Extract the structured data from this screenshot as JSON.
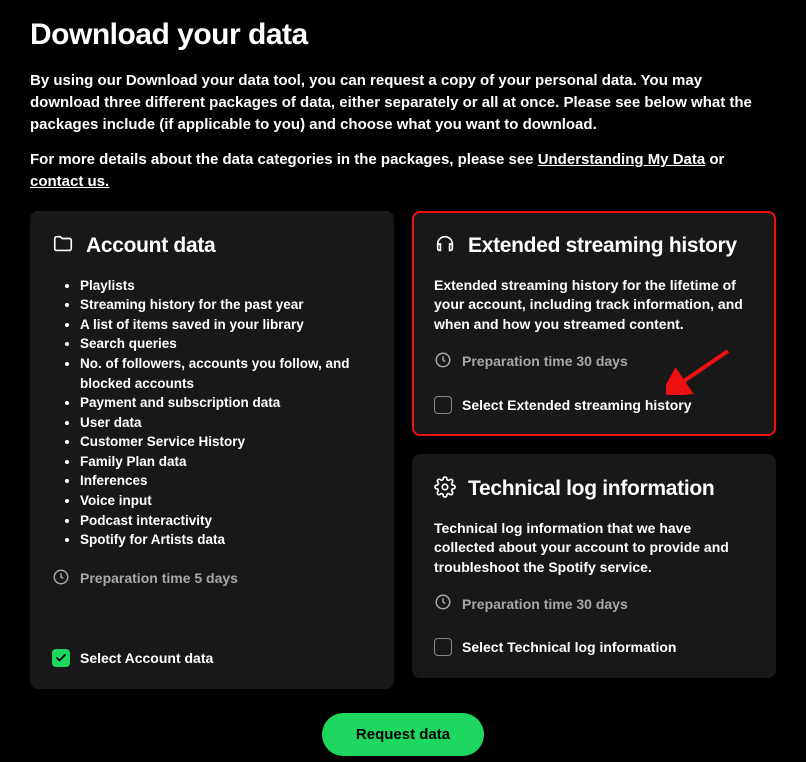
{
  "page_title": "Download your data",
  "intro_paragraph": "By using our Download your data tool, you can request a copy of your personal data. You may download three different packages of data, either separately or all at once. Please see below what the packages include (if applicable to you) and choose what you want to download.",
  "details_prefix": "For more details about the data categories in the packages, please see ",
  "details_link1": "Understanding My Data",
  "details_middle": " or ",
  "details_link2": "contact us.",
  "account_card": {
    "title": "Account data",
    "items": [
      "Playlists",
      "Streaming history for the past year",
      "A list of items saved in your library",
      "Search queries",
      "No. of followers, accounts you follow, and blocked accounts",
      "Payment and subscription data",
      "User data",
      "Customer Service History",
      "Family Plan data",
      "Inferences",
      "Voice input",
      "Podcast interactivity",
      "Spotify for Artists data"
    ],
    "prep_time": "Preparation time 5 days",
    "select_label": "Select Account data",
    "selected": true
  },
  "extended_card": {
    "title": "Extended streaming history",
    "description": "Extended streaming history for the lifetime of your account, including track information, and when and how you streamed content.",
    "prep_time": "Preparation time 30 days",
    "select_label": "Select Extended streaming history",
    "selected": false
  },
  "technical_card": {
    "title": "Technical log information",
    "description": "Technical log information that we have collected about your account to provide and troubleshoot the Spotify service.",
    "prep_time": "Preparation time 30 days",
    "select_label": "Select Technical log information",
    "selected": false
  },
  "request_button": "Request data"
}
